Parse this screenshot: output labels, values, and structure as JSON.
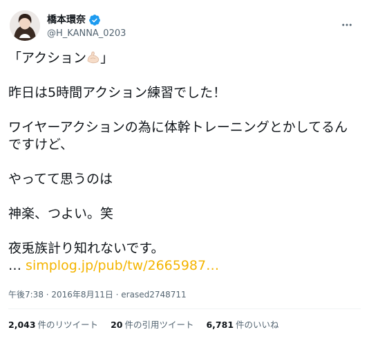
{
  "tweet": {
    "author": {
      "display_name": "橋本環奈",
      "handle": "@H_KANNA_0203",
      "verified": true,
      "verified_color": "#1d9bf0"
    },
    "text": {
      "line1_before": "「アクション",
      "line1_after": "」",
      "line2": "昨日は5時間アクション練習でした！",
      "line3": "ワイヤーアクションの為に体幹トレーニングとかしてるんですけど、",
      "line4": "やってて思うのは",
      "line5": "神楽、つよい。笑",
      "line6": "夜兎族計り知れないです。",
      "ellipsis": "…",
      "link": "simplog.jp/pub/tw/2665987…",
      "link_color": "#f4b400"
    },
    "meta": "午後7:38 · 2016年8月11日 · erased2748711",
    "stats": {
      "retweets": {
        "count": "2,043",
        "label": "件のリツイート"
      },
      "quotes": {
        "count": "20",
        "label": "件の引用ツイート"
      },
      "likes": {
        "count": "6,781",
        "label": "件のいいね"
      }
    }
  }
}
